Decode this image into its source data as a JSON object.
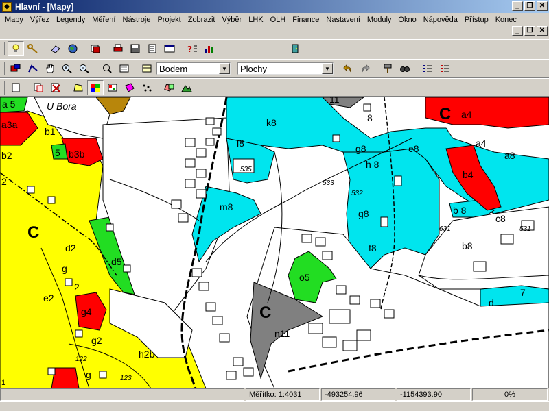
{
  "window": {
    "title": "Hlavní - [Mapy]"
  },
  "menu": [
    "Mapy",
    "Výřez",
    "Legendy",
    "Měření",
    "Nástroje",
    "Projekt",
    "Zobrazit",
    "Výběr",
    "LHK",
    "OLH",
    "Finance",
    "Nastavení",
    "Moduly",
    "Okno",
    "Nápověda",
    "Přístup",
    "Konec"
  ],
  "toolbar": {
    "mode_select": "Bodem",
    "layer_select": "Plochy"
  },
  "map": {
    "labels": {
      "a5": "a 5",
      "ubora": "U Bora",
      "a3a": "a3a",
      "b1": "b1",
      "b5": "5",
      "b3b": "b3b",
      "b2": "b2",
      "c_left": "C",
      "d2": "d2",
      "d5": "d5",
      "e2": "e2",
      "g_label": "g",
      "g4": "g4",
      "g2": "g2",
      "h2b": "h2b",
      "n122": "122",
      "n123": "123",
      "g_bottom": "g",
      "k8": "k8",
      "l8": "l8",
      "n535": "535",
      "n533": "533",
      "n532": "532",
      "g8a": "g8",
      "h8": "h 8",
      "e8": "e8",
      "g8b": "g8",
      "m8": "m8",
      "f8": "f8",
      "c_mid": "C",
      "o5": "o5",
      "n11": "n11",
      "c_right": "C",
      "a4a": "a4",
      "a4b": "a4",
      "a8": "a8",
      "b4": "b4",
      "b8a": "b  8",
      "c8": "c8",
      "b8b": "b8",
      "d_label": "d",
      "n7": "7",
      "n631": "631",
      "n531": "531",
      "n11top": "11",
      "n2a": "2",
      "n2b": "2",
      "n1": "1",
      "n8": "8"
    },
    "colors": {
      "cyan": "#00e5ee",
      "yellow": "#ffff00",
      "red": "#ff0000",
      "green": "#22dd22",
      "gray": "#808080",
      "brown": "#b8860b"
    }
  },
  "status": {
    "scale": "Měřítko: 1:4031",
    "x": "-493254.96",
    "y": "-1154393.90",
    "progress": "0%"
  }
}
